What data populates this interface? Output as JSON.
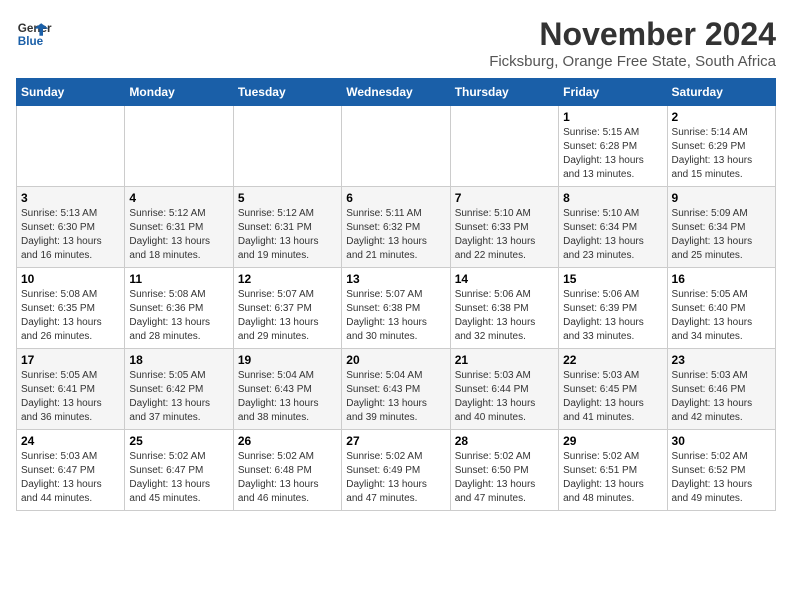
{
  "logo": {
    "line1": "General",
    "line2": "Blue"
  },
  "title": "November 2024",
  "subtitle": "Ficksburg, Orange Free State, South Africa",
  "days_of_week": [
    "Sunday",
    "Monday",
    "Tuesday",
    "Wednesday",
    "Thursday",
    "Friday",
    "Saturday"
  ],
  "weeks": [
    [
      {
        "day": "",
        "sunrise": "",
        "sunset": "",
        "daylight": ""
      },
      {
        "day": "",
        "sunrise": "",
        "sunset": "",
        "daylight": ""
      },
      {
        "day": "",
        "sunrise": "",
        "sunset": "",
        "daylight": ""
      },
      {
        "day": "",
        "sunrise": "",
        "sunset": "",
        "daylight": ""
      },
      {
        "day": "",
        "sunrise": "",
        "sunset": "",
        "daylight": ""
      },
      {
        "day": "1",
        "sunrise": "Sunrise: 5:15 AM",
        "sunset": "Sunset: 6:28 PM",
        "daylight": "Daylight: 13 hours and 13 minutes."
      },
      {
        "day": "2",
        "sunrise": "Sunrise: 5:14 AM",
        "sunset": "Sunset: 6:29 PM",
        "daylight": "Daylight: 13 hours and 15 minutes."
      }
    ],
    [
      {
        "day": "3",
        "sunrise": "Sunrise: 5:13 AM",
        "sunset": "Sunset: 6:30 PM",
        "daylight": "Daylight: 13 hours and 16 minutes."
      },
      {
        "day": "4",
        "sunrise": "Sunrise: 5:12 AM",
        "sunset": "Sunset: 6:31 PM",
        "daylight": "Daylight: 13 hours and 18 minutes."
      },
      {
        "day": "5",
        "sunrise": "Sunrise: 5:12 AM",
        "sunset": "Sunset: 6:31 PM",
        "daylight": "Daylight: 13 hours and 19 minutes."
      },
      {
        "day": "6",
        "sunrise": "Sunrise: 5:11 AM",
        "sunset": "Sunset: 6:32 PM",
        "daylight": "Daylight: 13 hours and 21 minutes."
      },
      {
        "day": "7",
        "sunrise": "Sunrise: 5:10 AM",
        "sunset": "Sunset: 6:33 PM",
        "daylight": "Daylight: 13 hours and 22 minutes."
      },
      {
        "day": "8",
        "sunrise": "Sunrise: 5:10 AM",
        "sunset": "Sunset: 6:34 PM",
        "daylight": "Daylight: 13 hours and 23 minutes."
      },
      {
        "day": "9",
        "sunrise": "Sunrise: 5:09 AM",
        "sunset": "Sunset: 6:34 PM",
        "daylight": "Daylight: 13 hours and 25 minutes."
      }
    ],
    [
      {
        "day": "10",
        "sunrise": "Sunrise: 5:08 AM",
        "sunset": "Sunset: 6:35 PM",
        "daylight": "Daylight: 13 hours and 26 minutes."
      },
      {
        "day": "11",
        "sunrise": "Sunrise: 5:08 AM",
        "sunset": "Sunset: 6:36 PM",
        "daylight": "Daylight: 13 hours and 28 minutes."
      },
      {
        "day": "12",
        "sunrise": "Sunrise: 5:07 AM",
        "sunset": "Sunset: 6:37 PM",
        "daylight": "Daylight: 13 hours and 29 minutes."
      },
      {
        "day": "13",
        "sunrise": "Sunrise: 5:07 AM",
        "sunset": "Sunset: 6:38 PM",
        "daylight": "Daylight: 13 hours and 30 minutes."
      },
      {
        "day": "14",
        "sunrise": "Sunrise: 5:06 AM",
        "sunset": "Sunset: 6:38 PM",
        "daylight": "Daylight: 13 hours and 32 minutes."
      },
      {
        "day": "15",
        "sunrise": "Sunrise: 5:06 AM",
        "sunset": "Sunset: 6:39 PM",
        "daylight": "Daylight: 13 hours and 33 minutes."
      },
      {
        "day": "16",
        "sunrise": "Sunrise: 5:05 AM",
        "sunset": "Sunset: 6:40 PM",
        "daylight": "Daylight: 13 hours and 34 minutes."
      }
    ],
    [
      {
        "day": "17",
        "sunrise": "Sunrise: 5:05 AM",
        "sunset": "Sunset: 6:41 PM",
        "daylight": "Daylight: 13 hours and 36 minutes."
      },
      {
        "day": "18",
        "sunrise": "Sunrise: 5:05 AM",
        "sunset": "Sunset: 6:42 PM",
        "daylight": "Daylight: 13 hours and 37 minutes."
      },
      {
        "day": "19",
        "sunrise": "Sunrise: 5:04 AM",
        "sunset": "Sunset: 6:43 PM",
        "daylight": "Daylight: 13 hours and 38 minutes."
      },
      {
        "day": "20",
        "sunrise": "Sunrise: 5:04 AM",
        "sunset": "Sunset: 6:43 PM",
        "daylight": "Daylight: 13 hours and 39 minutes."
      },
      {
        "day": "21",
        "sunrise": "Sunrise: 5:03 AM",
        "sunset": "Sunset: 6:44 PM",
        "daylight": "Daylight: 13 hours and 40 minutes."
      },
      {
        "day": "22",
        "sunrise": "Sunrise: 5:03 AM",
        "sunset": "Sunset: 6:45 PM",
        "daylight": "Daylight: 13 hours and 41 minutes."
      },
      {
        "day": "23",
        "sunrise": "Sunrise: 5:03 AM",
        "sunset": "Sunset: 6:46 PM",
        "daylight": "Daylight: 13 hours and 42 minutes."
      }
    ],
    [
      {
        "day": "24",
        "sunrise": "Sunrise: 5:03 AM",
        "sunset": "Sunset: 6:47 PM",
        "daylight": "Daylight: 13 hours and 44 minutes."
      },
      {
        "day": "25",
        "sunrise": "Sunrise: 5:02 AM",
        "sunset": "Sunset: 6:47 PM",
        "daylight": "Daylight: 13 hours and 45 minutes."
      },
      {
        "day": "26",
        "sunrise": "Sunrise: 5:02 AM",
        "sunset": "Sunset: 6:48 PM",
        "daylight": "Daylight: 13 hours and 46 minutes."
      },
      {
        "day": "27",
        "sunrise": "Sunrise: 5:02 AM",
        "sunset": "Sunset: 6:49 PM",
        "daylight": "Daylight: 13 hours and 47 minutes."
      },
      {
        "day": "28",
        "sunrise": "Sunrise: 5:02 AM",
        "sunset": "Sunset: 6:50 PM",
        "daylight": "Daylight: 13 hours and 47 minutes."
      },
      {
        "day": "29",
        "sunrise": "Sunrise: 5:02 AM",
        "sunset": "Sunset: 6:51 PM",
        "daylight": "Daylight: 13 hours and 48 minutes."
      },
      {
        "day": "30",
        "sunrise": "Sunrise: 5:02 AM",
        "sunset": "Sunset: 6:52 PM",
        "daylight": "Daylight: 13 hours and 49 minutes."
      }
    ]
  ]
}
